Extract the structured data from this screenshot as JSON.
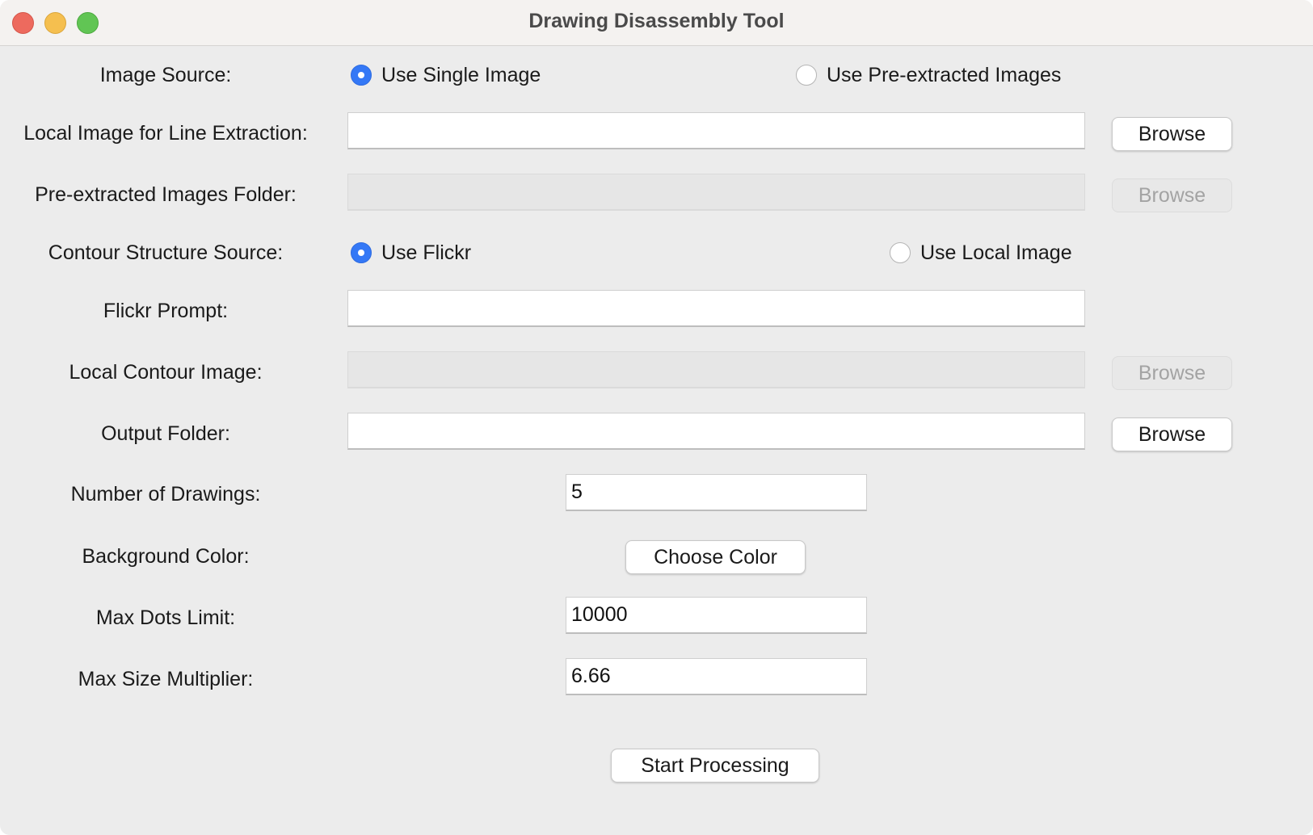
{
  "window": {
    "title": "Drawing Disassembly Tool"
  },
  "image_source": {
    "label": "Image Source:",
    "option_single": "Use Single Image",
    "option_pre": "Use Pre-extracted Images",
    "selected": "single"
  },
  "local_image": {
    "label": "Local Image for Line Extraction:",
    "value": "",
    "browse": "Browse"
  },
  "pre_extracted": {
    "label": "Pre-extracted Images Folder:",
    "value": "",
    "browse": "Browse",
    "enabled": false
  },
  "contour_source": {
    "label": "Contour Structure Source:",
    "option_flickr": "Use Flickr",
    "option_local": "Use Local Image",
    "selected": "flickr"
  },
  "flickr_prompt": {
    "label": "Flickr Prompt:",
    "value": ""
  },
  "local_contour": {
    "label": "Local Contour Image:",
    "value": "",
    "browse": "Browse",
    "enabled": false
  },
  "output_folder": {
    "label": "Output Folder:",
    "value": "",
    "browse": "Browse"
  },
  "num_drawings": {
    "label": "Number of Drawings:",
    "value": "5"
  },
  "background_color": {
    "label": "Background Color:",
    "button": "Choose Color"
  },
  "max_dots": {
    "label": "Max Dots Limit:",
    "value": "10000"
  },
  "max_size": {
    "label": "Max Size Multiplier:",
    "value": "6.66"
  },
  "start_button": "Start Processing",
  "colors": {
    "accent": "#3478f6",
    "window_bg": "#ececec",
    "close": "#ed6a5e",
    "minimize": "#f5bf4f",
    "maximize": "#61c554"
  }
}
